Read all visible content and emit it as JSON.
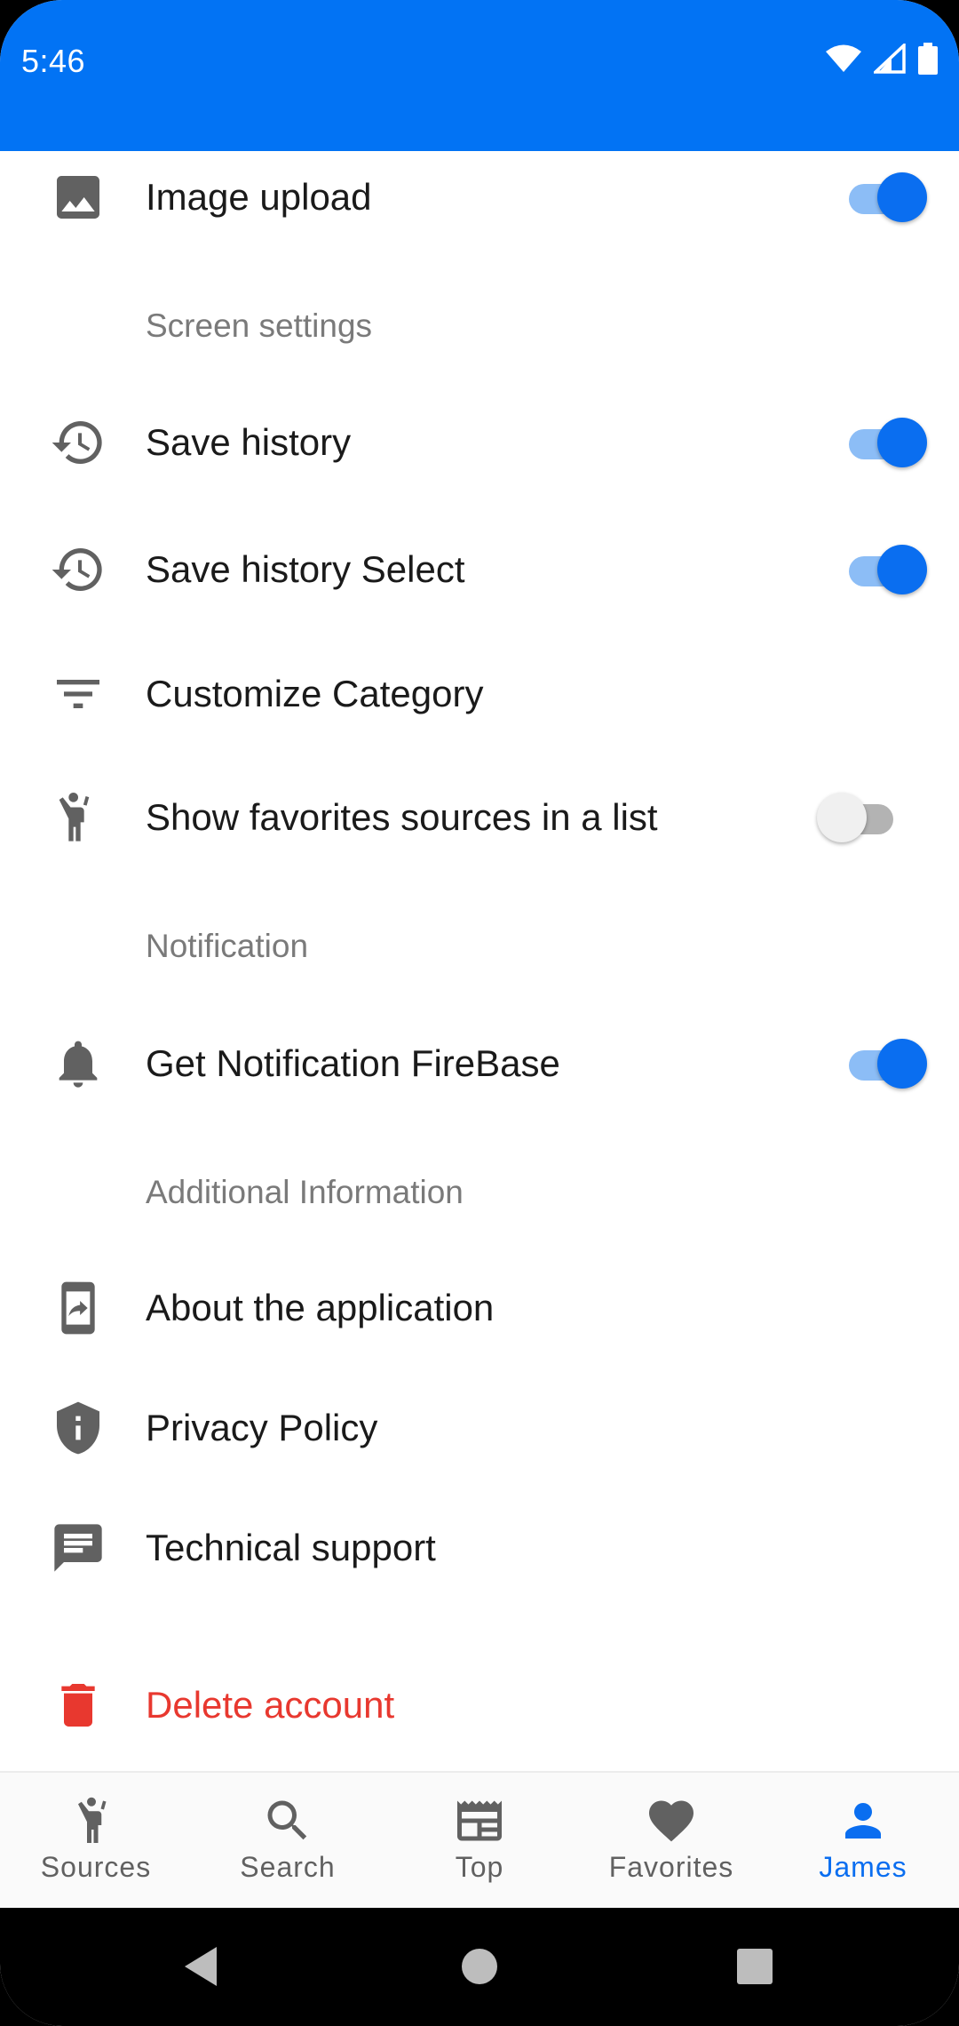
{
  "status_bar": {
    "time": "5:46",
    "icons": [
      "wifi-icon",
      "signal-icon",
      "battery-icon"
    ],
    "background": "#0273f4"
  },
  "settings": {
    "image_upload": {
      "label": "Image upload",
      "icon": "image-icon",
      "toggle": true
    },
    "screen_settings_header": "Screen settings",
    "save_history": {
      "label": "Save history",
      "icon": "history-icon",
      "toggle": true
    },
    "save_history_select": {
      "label": "Save history Select",
      "icon": "history-icon",
      "toggle": true
    },
    "customize_category": {
      "label": "Customize Category",
      "icon": "filter-icon"
    },
    "show_favorites": {
      "label": "Show favorites sources in a list",
      "icon": "person-wave-icon",
      "toggle": false
    },
    "notification_header": "Notification",
    "get_notification": {
      "label": "Get Notification FireBase",
      "icon": "bell-icon",
      "toggle": true
    },
    "additional_header": "Additional Information",
    "about": {
      "label": "About the application",
      "icon": "phone-share-icon"
    },
    "privacy": {
      "label": "Privacy Policy",
      "icon": "shield-info-icon"
    },
    "support": {
      "label": "Technical support",
      "icon": "chat-icon"
    },
    "delete_account": {
      "label": "Delete account",
      "icon": "trash-icon",
      "color": "#e8382f"
    }
  },
  "bottom_nav": {
    "items": [
      {
        "label": "Sources",
        "icon": "person-wave-icon",
        "active": false
      },
      {
        "label": "Search",
        "icon": "search-icon",
        "active": false
      },
      {
        "label": "Top",
        "icon": "newspaper-icon",
        "active": false
      },
      {
        "label": "Favorites",
        "icon": "heart-icon",
        "active": false
      },
      {
        "label": "James",
        "icon": "person-icon",
        "active": true
      }
    ],
    "active_color": "#0a6ef0"
  },
  "system_nav": {
    "buttons": [
      "back-icon",
      "home-icon",
      "recents-icon"
    ]
  }
}
